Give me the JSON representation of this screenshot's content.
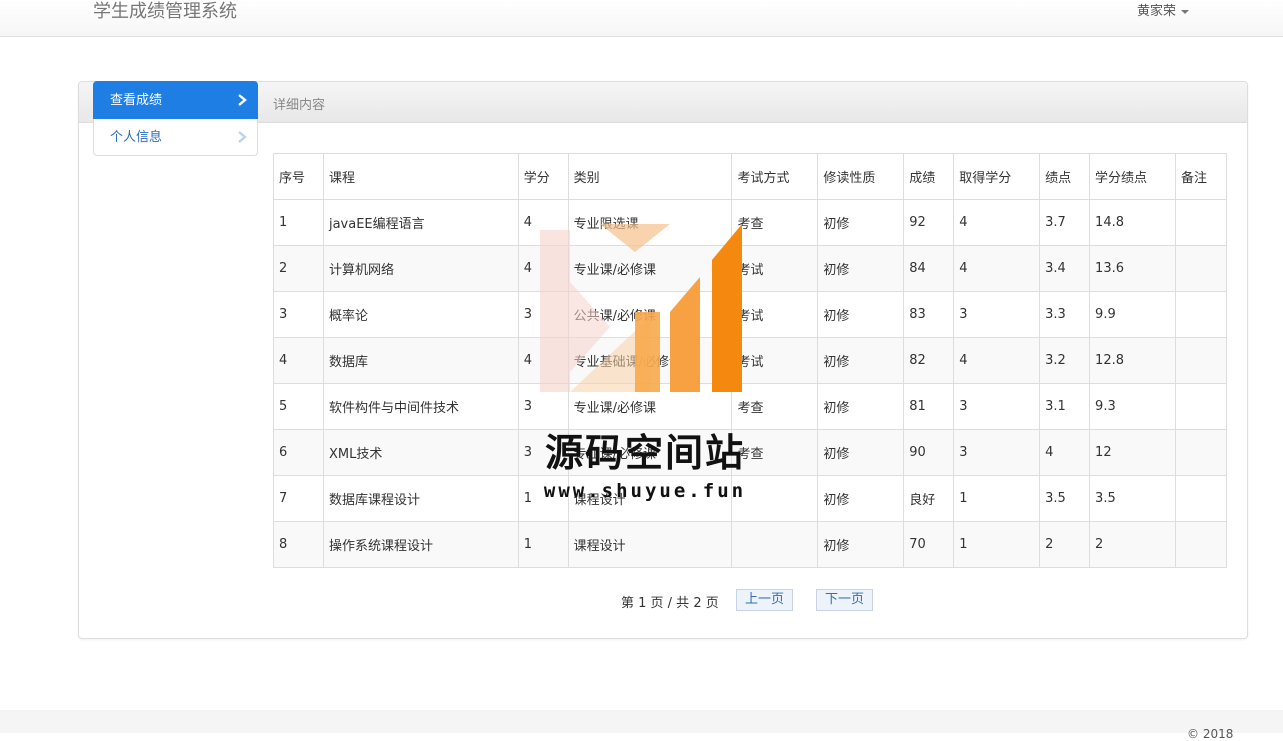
{
  "navbar": {
    "brand": "学生成绩管理系统",
    "user": "黄家荣"
  },
  "sidebar": {
    "items": [
      {
        "label": "查看成绩"
      },
      {
        "label": "个人信息"
      }
    ]
  },
  "panel": {
    "title": "详细内容"
  },
  "table": {
    "columns": [
      "序号",
      "课程",
      "学分",
      "类别",
      "考试方式",
      "修读性质",
      "成绩",
      "取得学分",
      "绩点",
      "学分绩点",
      "备注"
    ],
    "rows": [
      [
        "1",
        "javaEE编程语言",
        "4",
        "专业限选课",
        "考查",
        "初修",
        "92",
        "4",
        "3.7",
        "14.8",
        ""
      ],
      [
        "2",
        "计算机网络",
        "4",
        "专业课/必修课",
        "考试",
        "初修",
        "84",
        "4",
        "3.4",
        "13.6",
        ""
      ],
      [
        "3",
        "概率论",
        "3",
        "公共课/必修课",
        "考试",
        "初修",
        "83",
        "3",
        "3.3",
        "9.9",
        ""
      ],
      [
        "4",
        "数据库",
        "4",
        "专业基础课/必修课",
        "考试",
        "初修",
        "82",
        "4",
        "3.2",
        "12.8",
        ""
      ],
      [
        "5",
        "软件构件与中间件技术",
        "3",
        "专业课/必修课",
        "考查",
        "初修",
        "81",
        "3",
        "3.1",
        "9.3",
        ""
      ],
      [
        "6",
        "XML技术",
        "3",
        "专业课/必修课",
        "考查",
        "初修",
        "90",
        "3",
        "4",
        "12",
        ""
      ],
      [
        "7",
        "数据库课程设计",
        "1",
        "课程设计",
        "",
        "初修",
        "良好",
        "1",
        "3.5",
        "3.5",
        ""
      ],
      [
        "8",
        "操作系统课程设计",
        "1",
        "课程设计",
        "",
        "初修",
        "70",
        "1",
        "2",
        "2",
        ""
      ]
    ]
  },
  "pager": {
    "info": "第 1 页 / 共 2 页",
    "prev": "上一页",
    "next": "下一页"
  },
  "watermark": {
    "title": "源码空间站",
    "url": "www.shuyue.fun"
  },
  "footer": {
    "text": "© 2018"
  },
  "colors": {
    "primary": "#1f7ee3",
    "link": "#2a6dc0",
    "watermark_orange": "#f5890f"
  }
}
